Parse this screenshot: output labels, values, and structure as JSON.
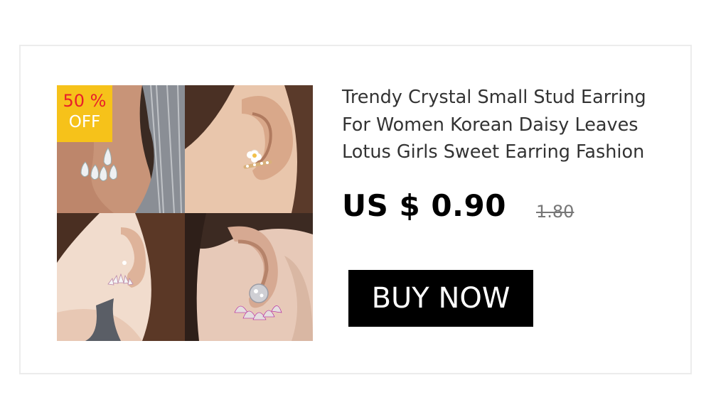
{
  "discount_badge": {
    "percent": "50 %",
    "label": "OFF"
  },
  "product": {
    "title": "Trendy Crystal Small Stud Earring For Women Korean Daisy Leaves Lotus Girls Sweet Earring Fashion",
    "price": "US $ 0.90",
    "original_price": "1.80"
  },
  "buy_button": {
    "label": "BUY NOW"
  },
  "colors": {
    "badge_background": "#f6c21a",
    "badge_percent_text": "#e8202a",
    "button_background": "#000000"
  }
}
